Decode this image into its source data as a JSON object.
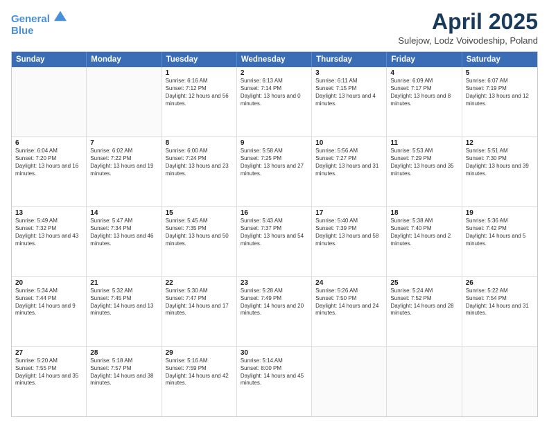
{
  "header": {
    "logo_line1": "General",
    "logo_line2": "Blue",
    "month": "April 2025",
    "location": "Sulejow, Lodz Voivodeship, Poland"
  },
  "weekdays": [
    "Sunday",
    "Monday",
    "Tuesday",
    "Wednesday",
    "Thursday",
    "Friday",
    "Saturday"
  ],
  "rows": [
    [
      {
        "day": "",
        "text": ""
      },
      {
        "day": "",
        "text": ""
      },
      {
        "day": "1",
        "text": "Sunrise: 6:16 AM\nSunset: 7:12 PM\nDaylight: 12 hours and 56 minutes."
      },
      {
        "day": "2",
        "text": "Sunrise: 6:13 AM\nSunset: 7:14 PM\nDaylight: 13 hours and 0 minutes."
      },
      {
        "day": "3",
        "text": "Sunrise: 6:11 AM\nSunset: 7:15 PM\nDaylight: 13 hours and 4 minutes."
      },
      {
        "day": "4",
        "text": "Sunrise: 6:09 AM\nSunset: 7:17 PM\nDaylight: 13 hours and 8 minutes."
      },
      {
        "day": "5",
        "text": "Sunrise: 6:07 AM\nSunset: 7:19 PM\nDaylight: 13 hours and 12 minutes."
      }
    ],
    [
      {
        "day": "6",
        "text": "Sunrise: 6:04 AM\nSunset: 7:20 PM\nDaylight: 13 hours and 16 minutes."
      },
      {
        "day": "7",
        "text": "Sunrise: 6:02 AM\nSunset: 7:22 PM\nDaylight: 13 hours and 19 minutes."
      },
      {
        "day": "8",
        "text": "Sunrise: 6:00 AM\nSunset: 7:24 PM\nDaylight: 13 hours and 23 minutes."
      },
      {
        "day": "9",
        "text": "Sunrise: 5:58 AM\nSunset: 7:25 PM\nDaylight: 13 hours and 27 minutes."
      },
      {
        "day": "10",
        "text": "Sunrise: 5:56 AM\nSunset: 7:27 PM\nDaylight: 13 hours and 31 minutes."
      },
      {
        "day": "11",
        "text": "Sunrise: 5:53 AM\nSunset: 7:29 PM\nDaylight: 13 hours and 35 minutes."
      },
      {
        "day": "12",
        "text": "Sunrise: 5:51 AM\nSunset: 7:30 PM\nDaylight: 13 hours and 39 minutes."
      }
    ],
    [
      {
        "day": "13",
        "text": "Sunrise: 5:49 AM\nSunset: 7:32 PM\nDaylight: 13 hours and 43 minutes."
      },
      {
        "day": "14",
        "text": "Sunrise: 5:47 AM\nSunset: 7:34 PM\nDaylight: 13 hours and 46 minutes."
      },
      {
        "day": "15",
        "text": "Sunrise: 5:45 AM\nSunset: 7:35 PM\nDaylight: 13 hours and 50 minutes."
      },
      {
        "day": "16",
        "text": "Sunrise: 5:43 AM\nSunset: 7:37 PM\nDaylight: 13 hours and 54 minutes."
      },
      {
        "day": "17",
        "text": "Sunrise: 5:40 AM\nSunset: 7:39 PM\nDaylight: 13 hours and 58 minutes."
      },
      {
        "day": "18",
        "text": "Sunrise: 5:38 AM\nSunset: 7:40 PM\nDaylight: 14 hours and 2 minutes."
      },
      {
        "day": "19",
        "text": "Sunrise: 5:36 AM\nSunset: 7:42 PM\nDaylight: 14 hours and 5 minutes."
      }
    ],
    [
      {
        "day": "20",
        "text": "Sunrise: 5:34 AM\nSunset: 7:44 PM\nDaylight: 14 hours and 9 minutes."
      },
      {
        "day": "21",
        "text": "Sunrise: 5:32 AM\nSunset: 7:45 PM\nDaylight: 14 hours and 13 minutes."
      },
      {
        "day": "22",
        "text": "Sunrise: 5:30 AM\nSunset: 7:47 PM\nDaylight: 14 hours and 17 minutes."
      },
      {
        "day": "23",
        "text": "Sunrise: 5:28 AM\nSunset: 7:49 PM\nDaylight: 14 hours and 20 minutes."
      },
      {
        "day": "24",
        "text": "Sunrise: 5:26 AM\nSunset: 7:50 PM\nDaylight: 14 hours and 24 minutes."
      },
      {
        "day": "25",
        "text": "Sunrise: 5:24 AM\nSunset: 7:52 PM\nDaylight: 14 hours and 28 minutes."
      },
      {
        "day": "26",
        "text": "Sunrise: 5:22 AM\nSunset: 7:54 PM\nDaylight: 14 hours and 31 minutes."
      }
    ],
    [
      {
        "day": "27",
        "text": "Sunrise: 5:20 AM\nSunset: 7:55 PM\nDaylight: 14 hours and 35 minutes."
      },
      {
        "day": "28",
        "text": "Sunrise: 5:18 AM\nSunset: 7:57 PM\nDaylight: 14 hours and 38 minutes."
      },
      {
        "day": "29",
        "text": "Sunrise: 5:16 AM\nSunset: 7:59 PM\nDaylight: 14 hours and 42 minutes."
      },
      {
        "day": "30",
        "text": "Sunrise: 5:14 AM\nSunset: 8:00 PM\nDaylight: 14 hours and 45 minutes."
      },
      {
        "day": "",
        "text": ""
      },
      {
        "day": "",
        "text": ""
      },
      {
        "day": "",
        "text": ""
      }
    ]
  ]
}
